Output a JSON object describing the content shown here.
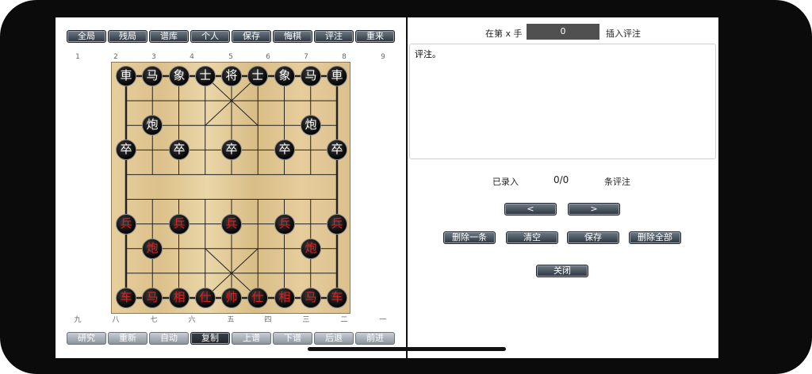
{
  "top_buttons": [
    "全局",
    "残局",
    "谱库",
    "个人",
    "保存",
    "悔棋",
    "评注",
    "重来"
  ],
  "bottom_buttons": [
    "研究",
    "重新",
    "自动",
    "复制",
    "上谱",
    "下谱",
    "后退",
    "前进"
  ],
  "top_coords": [
    "1",
    "2",
    "3",
    "4",
    "5",
    "6",
    "7",
    "8",
    "9"
  ],
  "bottom_coords": [
    "九",
    "八",
    "七",
    "六",
    "五",
    "四",
    "三",
    "二",
    "一"
  ],
  "pieces": {
    "black_back_row": [
      "車",
      "马",
      "象",
      "士",
      "将",
      "士",
      "象",
      "马",
      "車"
    ],
    "black_cannon": "炮",
    "black_soldier": "卒",
    "red_soldier": "兵",
    "red_cannon": "炮",
    "red_back_row": [
      "车",
      "马",
      "相",
      "仕",
      "帅",
      "仕",
      "相",
      "马",
      "车"
    ]
  },
  "comment": {
    "prefix": "在第 x 手",
    "move_value": "0",
    "insert_label": "插入评注",
    "text": "评注。",
    "recorded_label": "已录入",
    "count": "0/0",
    "count_suffix": "条评注",
    "prev_label": "<",
    "next_label": ">",
    "delete_one": "删除一条",
    "clear": "清空",
    "save": "保存",
    "delete_all": "删除全部",
    "close": "关闭"
  }
}
